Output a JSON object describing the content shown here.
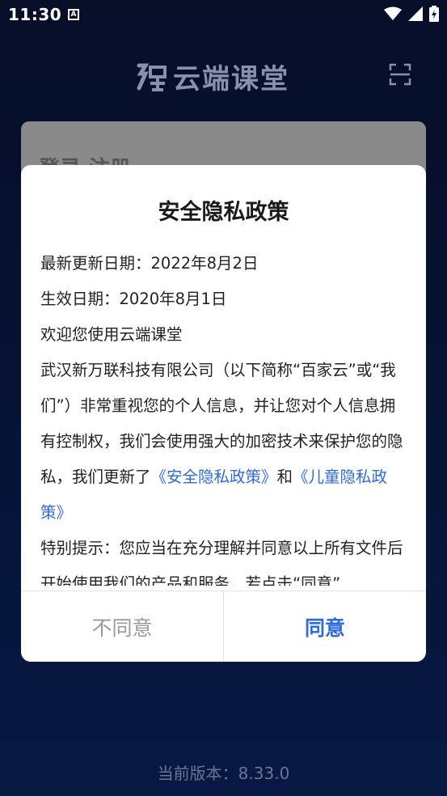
{
  "status_bar": {
    "time": "11:30",
    "a_icon": "A"
  },
  "app": {
    "logo_text": "云端课堂"
  },
  "background_card": {
    "text": "登录·注册"
  },
  "version_text": "当前版本：8.33.0",
  "dialog": {
    "title": "安全隐私政策",
    "updated": "最新更新日期：2022年8月2日",
    "effective": "生效日期：2020年8月1日",
    "welcome": "欢迎您使用云端课堂",
    "para1_a": "武汉新万联科技有限公司（以下简称“百家云”或“我们”）非常重视您的个人信息，并让您对个人信息拥有控制权，我们会使用强大的加密技术来保护您的隐私，我们更新了",
    "link_privacy": "《安全隐私政策》",
    "para1_and": "和",
    "link_child": "《儿童隐私政策》",
    "para2": "特别提示：您应当在充分理解并同意以上所有文件后开始使用我们的产品和服务，若点击“同意”",
    "disagree_label": "不同意",
    "agree_label": "同意"
  },
  "colors": {
    "accent": "#2f6bdc",
    "background": "#0e2d7a"
  }
}
